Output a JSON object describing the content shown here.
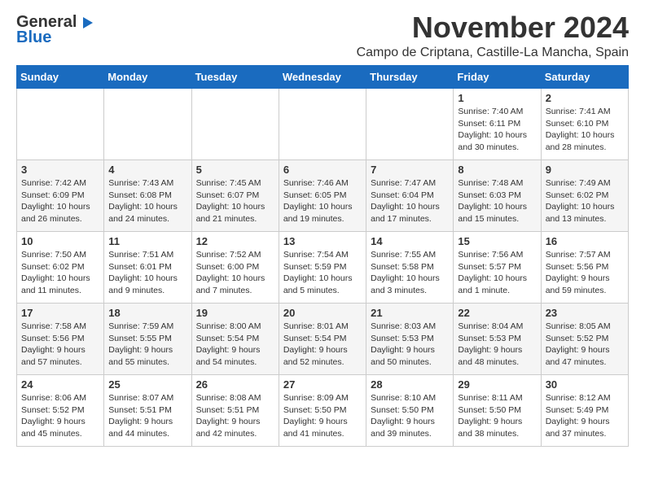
{
  "logo": {
    "line1": "General",
    "line2": "Blue"
  },
  "title": "November 2024",
  "location": "Campo de Criptana, Castille-La Mancha, Spain",
  "weekdays": [
    "Sunday",
    "Monday",
    "Tuesday",
    "Wednesday",
    "Thursday",
    "Friday",
    "Saturday"
  ],
  "weeks": [
    [
      {
        "day": "",
        "info": ""
      },
      {
        "day": "",
        "info": ""
      },
      {
        "day": "",
        "info": ""
      },
      {
        "day": "",
        "info": ""
      },
      {
        "day": "",
        "info": ""
      },
      {
        "day": "1",
        "info": "Sunrise: 7:40 AM\nSunset: 6:11 PM\nDaylight: 10 hours\nand 30 minutes."
      },
      {
        "day": "2",
        "info": "Sunrise: 7:41 AM\nSunset: 6:10 PM\nDaylight: 10 hours\nand 28 minutes."
      }
    ],
    [
      {
        "day": "3",
        "info": "Sunrise: 7:42 AM\nSunset: 6:09 PM\nDaylight: 10 hours\nand 26 minutes."
      },
      {
        "day": "4",
        "info": "Sunrise: 7:43 AM\nSunset: 6:08 PM\nDaylight: 10 hours\nand 24 minutes."
      },
      {
        "day": "5",
        "info": "Sunrise: 7:45 AM\nSunset: 6:07 PM\nDaylight: 10 hours\nand 21 minutes."
      },
      {
        "day": "6",
        "info": "Sunrise: 7:46 AM\nSunset: 6:05 PM\nDaylight: 10 hours\nand 19 minutes."
      },
      {
        "day": "7",
        "info": "Sunrise: 7:47 AM\nSunset: 6:04 PM\nDaylight: 10 hours\nand 17 minutes."
      },
      {
        "day": "8",
        "info": "Sunrise: 7:48 AM\nSunset: 6:03 PM\nDaylight: 10 hours\nand 15 minutes."
      },
      {
        "day": "9",
        "info": "Sunrise: 7:49 AM\nSunset: 6:02 PM\nDaylight: 10 hours\nand 13 minutes."
      }
    ],
    [
      {
        "day": "10",
        "info": "Sunrise: 7:50 AM\nSunset: 6:02 PM\nDaylight: 10 hours\nand 11 minutes."
      },
      {
        "day": "11",
        "info": "Sunrise: 7:51 AM\nSunset: 6:01 PM\nDaylight: 10 hours\nand 9 minutes."
      },
      {
        "day": "12",
        "info": "Sunrise: 7:52 AM\nSunset: 6:00 PM\nDaylight: 10 hours\nand 7 minutes."
      },
      {
        "day": "13",
        "info": "Sunrise: 7:54 AM\nSunset: 5:59 PM\nDaylight: 10 hours\nand 5 minutes."
      },
      {
        "day": "14",
        "info": "Sunrise: 7:55 AM\nSunset: 5:58 PM\nDaylight: 10 hours\nand 3 minutes."
      },
      {
        "day": "15",
        "info": "Sunrise: 7:56 AM\nSunset: 5:57 PM\nDaylight: 10 hours\nand 1 minute."
      },
      {
        "day": "16",
        "info": "Sunrise: 7:57 AM\nSunset: 5:56 PM\nDaylight: 9 hours\nand 59 minutes."
      }
    ],
    [
      {
        "day": "17",
        "info": "Sunrise: 7:58 AM\nSunset: 5:56 PM\nDaylight: 9 hours\nand 57 minutes."
      },
      {
        "day": "18",
        "info": "Sunrise: 7:59 AM\nSunset: 5:55 PM\nDaylight: 9 hours\nand 55 minutes."
      },
      {
        "day": "19",
        "info": "Sunrise: 8:00 AM\nSunset: 5:54 PM\nDaylight: 9 hours\nand 54 minutes."
      },
      {
        "day": "20",
        "info": "Sunrise: 8:01 AM\nSunset: 5:54 PM\nDaylight: 9 hours\nand 52 minutes."
      },
      {
        "day": "21",
        "info": "Sunrise: 8:03 AM\nSunset: 5:53 PM\nDaylight: 9 hours\nand 50 minutes."
      },
      {
        "day": "22",
        "info": "Sunrise: 8:04 AM\nSunset: 5:53 PM\nDaylight: 9 hours\nand 48 minutes."
      },
      {
        "day": "23",
        "info": "Sunrise: 8:05 AM\nSunset: 5:52 PM\nDaylight: 9 hours\nand 47 minutes."
      }
    ],
    [
      {
        "day": "24",
        "info": "Sunrise: 8:06 AM\nSunset: 5:52 PM\nDaylight: 9 hours\nand 45 minutes."
      },
      {
        "day": "25",
        "info": "Sunrise: 8:07 AM\nSunset: 5:51 PM\nDaylight: 9 hours\nand 44 minutes."
      },
      {
        "day": "26",
        "info": "Sunrise: 8:08 AM\nSunset: 5:51 PM\nDaylight: 9 hours\nand 42 minutes."
      },
      {
        "day": "27",
        "info": "Sunrise: 8:09 AM\nSunset: 5:50 PM\nDaylight: 9 hours\nand 41 minutes."
      },
      {
        "day": "28",
        "info": "Sunrise: 8:10 AM\nSunset: 5:50 PM\nDaylight: 9 hours\nand 39 minutes."
      },
      {
        "day": "29",
        "info": "Sunrise: 8:11 AM\nSunset: 5:50 PM\nDaylight: 9 hours\nand 38 minutes."
      },
      {
        "day": "30",
        "info": "Sunrise: 8:12 AM\nSunset: 5:49 PM\nDaylight: 9 hours\nand 37 minutes."
      }
    ]
  ]
}
